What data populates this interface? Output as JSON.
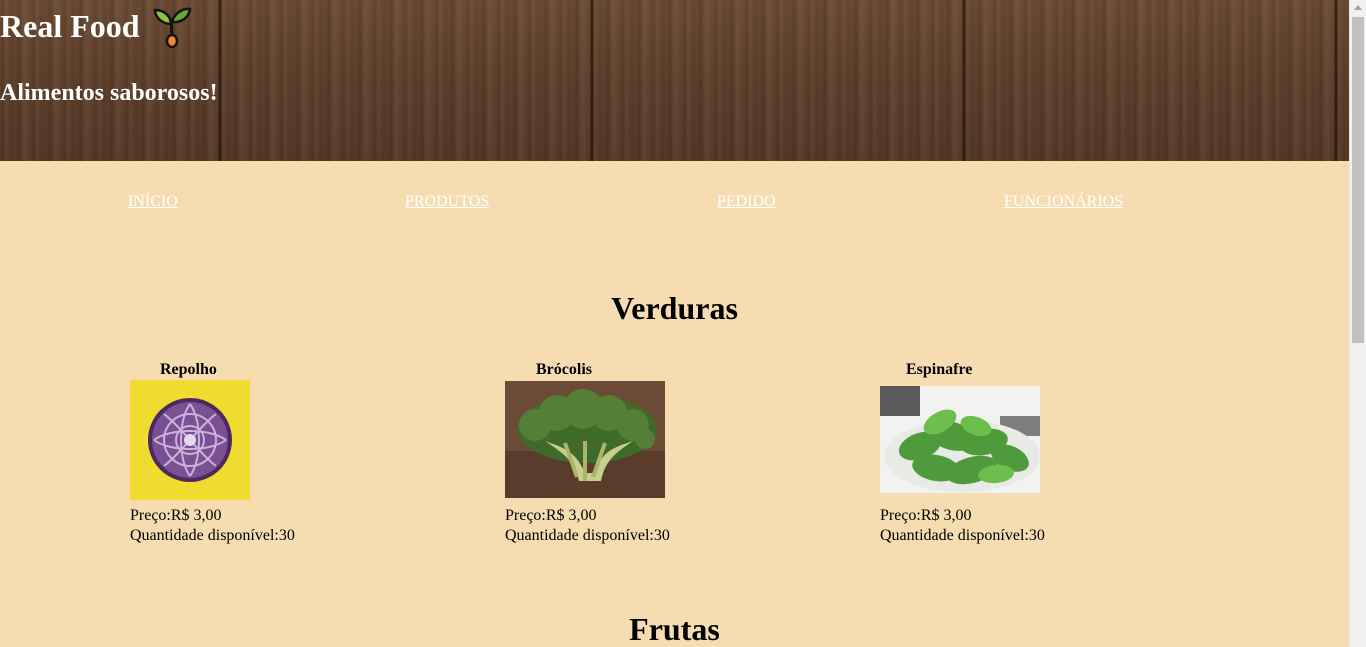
{
  "header": {
    "title": "Real Food",
    "tagline": "Alimentos saborosos!",
    "logo_icon": "sprout-icon"
  },
  "nav": {
    "items": [
      {
        "label": "INÍCIO"
      },
      {
        "label": "PRODUTOS"
      },
      {
        "label": "PEDIDO"
      },
      {
        "label": "FUNCIONÁRIOS"
      }
    ]
  },
  "sections": [
    {
      "title": "Verduras",
      "products": [
        {
          "name": "Repolho",
          "price_label": "Preço:",
          "price": "R$ 3,00",
          "qty_label": "Quantidade disponível:",
          "qty": "30",
          "image": "red-cabbage-image"
        },
        {
          "name": "Brócolis",
          "price_label": "Preço:",
          "price": "R$ 3,00",
          "qty_label": "Quantidade disponível:",
          "qty": "30",
          "image": "broccoli-image"
        },
        {
          "name": "Espinafre",
          "price_label": "Preço:",
          "price": "R$ 3,00",
          "qty_label": "Quantidade disponível:",
          "qty": "30",
          "image": "spinach-image"
        }
      ]
    },
    {
      "title": "Frutas",
      "products": []
    }
  ],
  "colors": {
    "page_background": "#f5dcb1",
    "header_wood": "#5e3f2b",
    "nav_link": "#ffffff"
  }
}
